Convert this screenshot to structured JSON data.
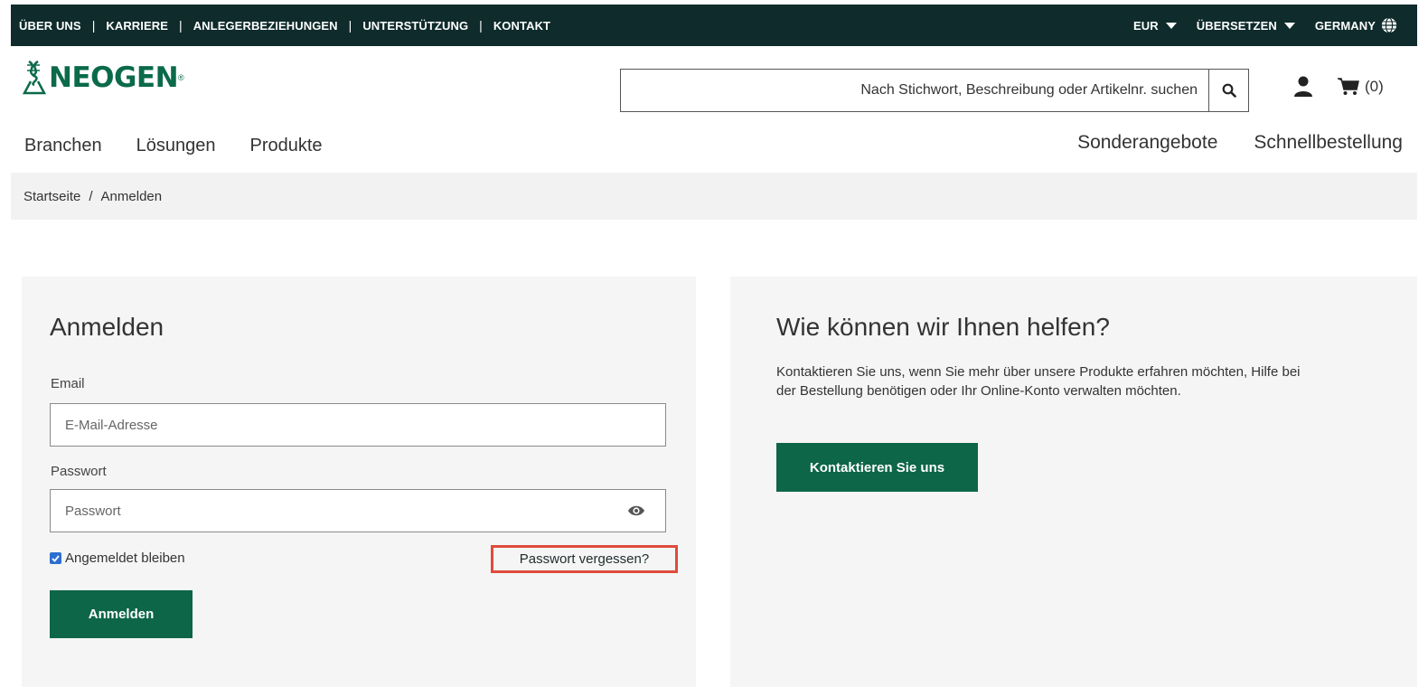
{
  "topbar": {
    "links": [
      "ÜBER UNS",
      "KARRIERE",
      "ANLEGERBEZIEHUNGEN",
      "UNTERSTÜTZUNG",
      "KONTAKT"
    ],
    "currency": "EUR",
    "translate": "ÜBERSETZEN",
    "region": "GERMANY"
  },
  "header": {
    "logo_text": "NEOGEN",
    "logo_mark": "®",
    "search_placeholder": "Nach Stichwort, Beschreibung oder Artikelnr. suchen",
    "cart_count": "(0)"
  },
  "nav": {
    "left": [
      "Branchen",
      "Lösungen",
      "Produkte"
    ],
    "right": [
      "Sonderangebote",
      "Schnellbestellung"
    ]
  },
  "breadcrumb": {
    "home": "Startseite",
    "separator": "/",
    "current": "Anmelden"
  },
  "login": {
    "title": "Anmelden",
    "email_label": "Email",
    "email_placeholder": "E-Mail-Adresse",
    "password_label": "Passwort",
    "password_placeholder": "Passwort",
    "remember_label": "Angemeldet bleiben",
    "remember_checked": true,
    "forgot_link": "Passwort vergessen?",
    "submit": "Anmelden"
  },
  "help": {
    "title": "Wie können wir Ihnen helfen?",
    "text": "Kontaktieren Sie uns, wenn Sie mehr über unsere Produkte erfahren möchten, Hilfe bei der Bestellung benötigen oder Ihr Online-Konto verwalten möchten.",
    "button": "Kontaktieren Sie uns"
  },
  "colors": {
    "topbar_bg": "#0f2b2b",
    "brand_green": "#0d6647",
    "panel_bg": "#f5f5f5",
    "highlight_border": "#e04b3b",
    "checkbox_blue": "#2b6fd1"
  }
}
